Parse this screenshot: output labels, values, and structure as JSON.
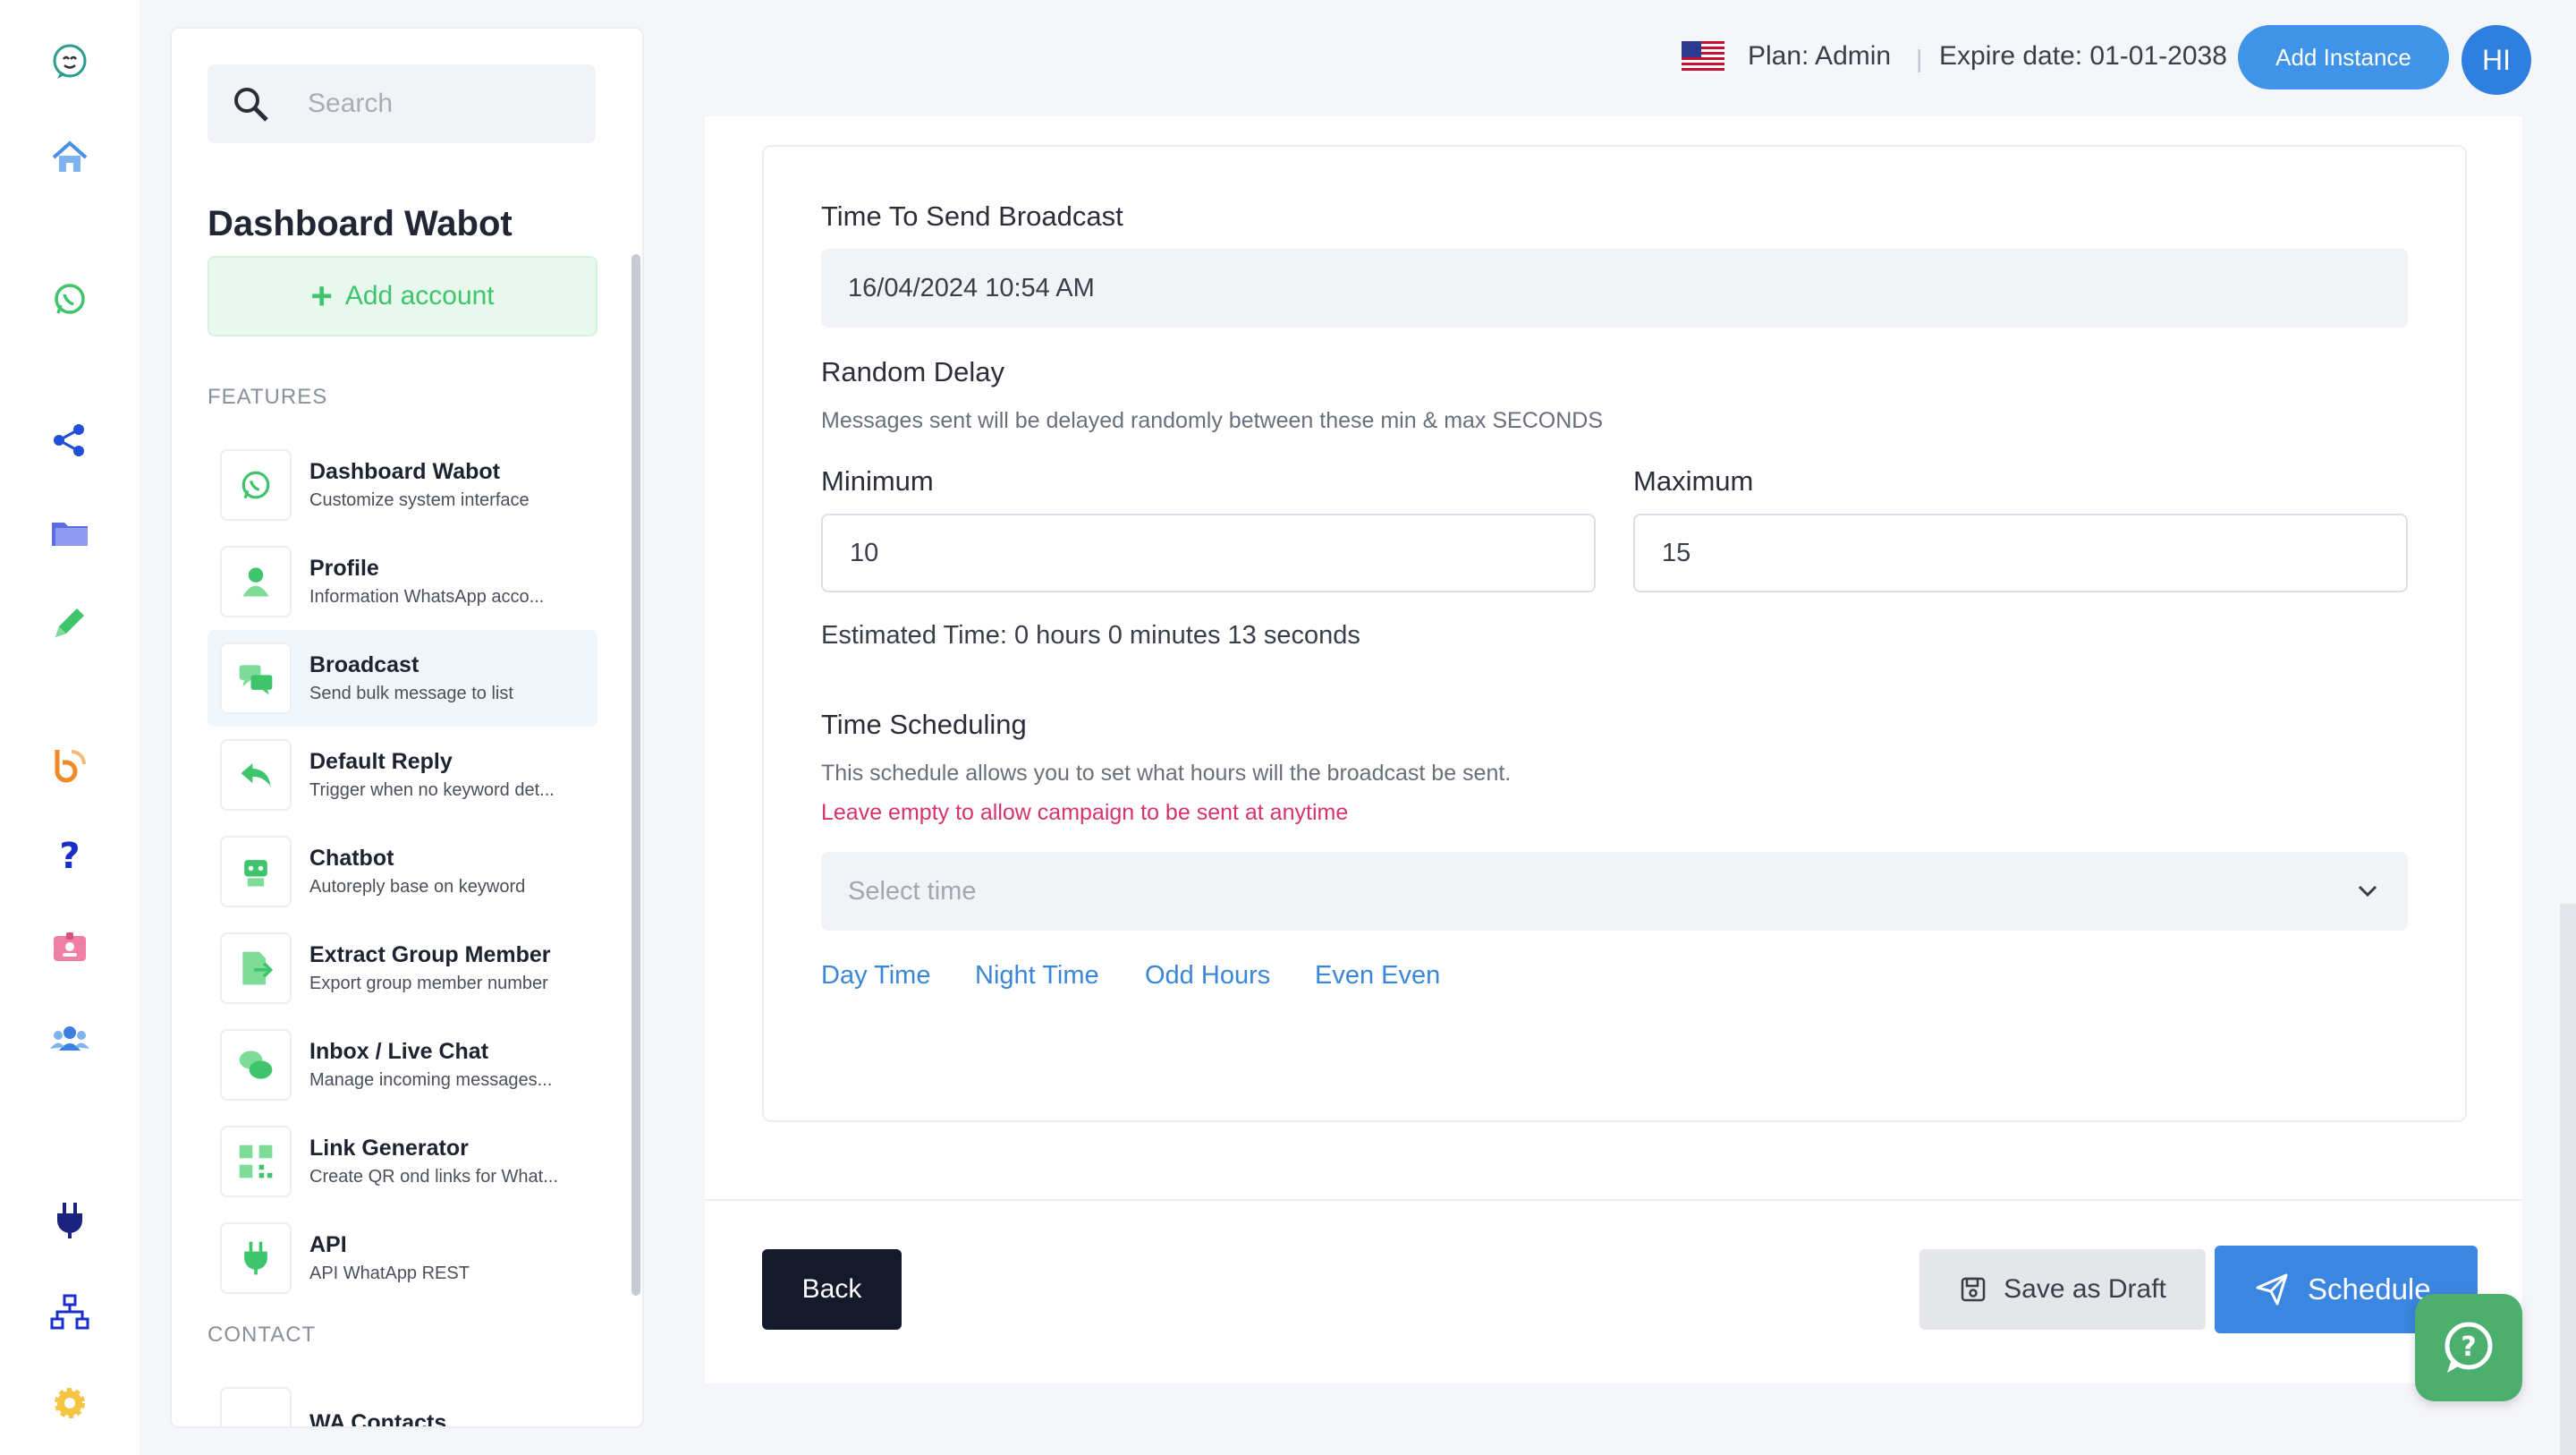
{
  "colors": {
    "accent_blue": "#3f94ea",
    "accent_green": "#3ec46a",
    "warning_red": "#d6336c",
    "dark_button": "#141a2b"
  },
  "rail": {
    "icons": [
      "logo-icon",
      "home-icon",
      "whatsapp-icon",
      "share-nodes-icon",
      "folder-icon",
      "edit-pencil-icon",
      "blog-icon",
      "question-icon",
      "id-badge-icon",
      "users-icon",
      "plug-icon",
      "network-icon",
      "gear-icon"
    ]
  },
  "sidebar": {
    "search_placeholder": "Search",
    "title": "Dashboard Wabot",
    "add_account": "Add account",
    "features_label": "FEATURES",
    "contact_label": "CONTACT",
    "items": [
      {
        "title": "Dashboard Wabot",
        "subtitle": "Customize system interface",
        "icon": "whatsapp-icon"
      },
      {
        "title": "Profile",
        "subtitle": "Information WhatsApp acco...",
        "icon": "user-icon"
      },
      {
        "title": "Broadcast",
        "subtitle": "Send bulk message to list",
        "icon": "chat-bubbles-icon"
      },
      {
        "title": "Default Reply",
        "subtitle": "Trigger when no keyword det...",
        "icon": "reply-icon"
      },
      {
        "title": "Chatbot",
        "subtitle": "Autoreply base on keyword",
        "icon": "robot-icon"
      },
      {
        "title": "Extract Group Member",
        "subtitle": "Export group member number",
        "icon": "export-file-icon"
      },
      {
        "title": "Inbox / Live Chat",
        "subtitle": "Manage incoming messages...",
        "icon": "comments-icon"
      },
      {
        "title": "Link Generator",
        "subtitle": "Create QR ond links for What...",
        "icon": "qr-code-icon"
      },
      {
        "title": "API",
        "subtitle": "API WhatApp REST",
        "icon": "plug-icon"
      }
    ],
    "contact_partial": "WA Contacts"
  },
  "topbar": {
    "plan": "Plan: Admin",
    "separator": "|",
    "expire": "Expire date: 01-01-2038",
    "add_instance": "Add Instance",
    "avatar_initials": "HI"
  },
  "form": {
    "time_to_send_label": "Time To Send Broadcast",
    "time_to_send_value": "16/04/2024 10:54 AM",
    "random_delay_label": "Random Delay",
    "random_delay_hint": "Messages sent will be delayed randomly between these min & max SECONDS",
    "minimum_label": "Minimum",
    "minimum_value": "10",
    "maximum_label": "Maximum",
    "maximum_value": "15",
    "estimated_time": "Estimated Time: 0 hours 0 minutes 13 seconds",
    "scheduling_label": "Time Scheduling",
    "scheduling_hint": "This schedule allows you to set what hours will the broadcast be sent.",
    "scheduling_warning": "Leave empty to allow campaign to be sent at anytime",
    "select_time_placeholder": "Select time",
    "quick_options": [
      "Day Time",
      "Night Time",
      "Odd Hours",
      "Even Even"
    ]
  },
  "footer": {
    "back": "Back",
    "save_draft": "Save as Draft",
    "schedule": "Schedule"
  }
}
